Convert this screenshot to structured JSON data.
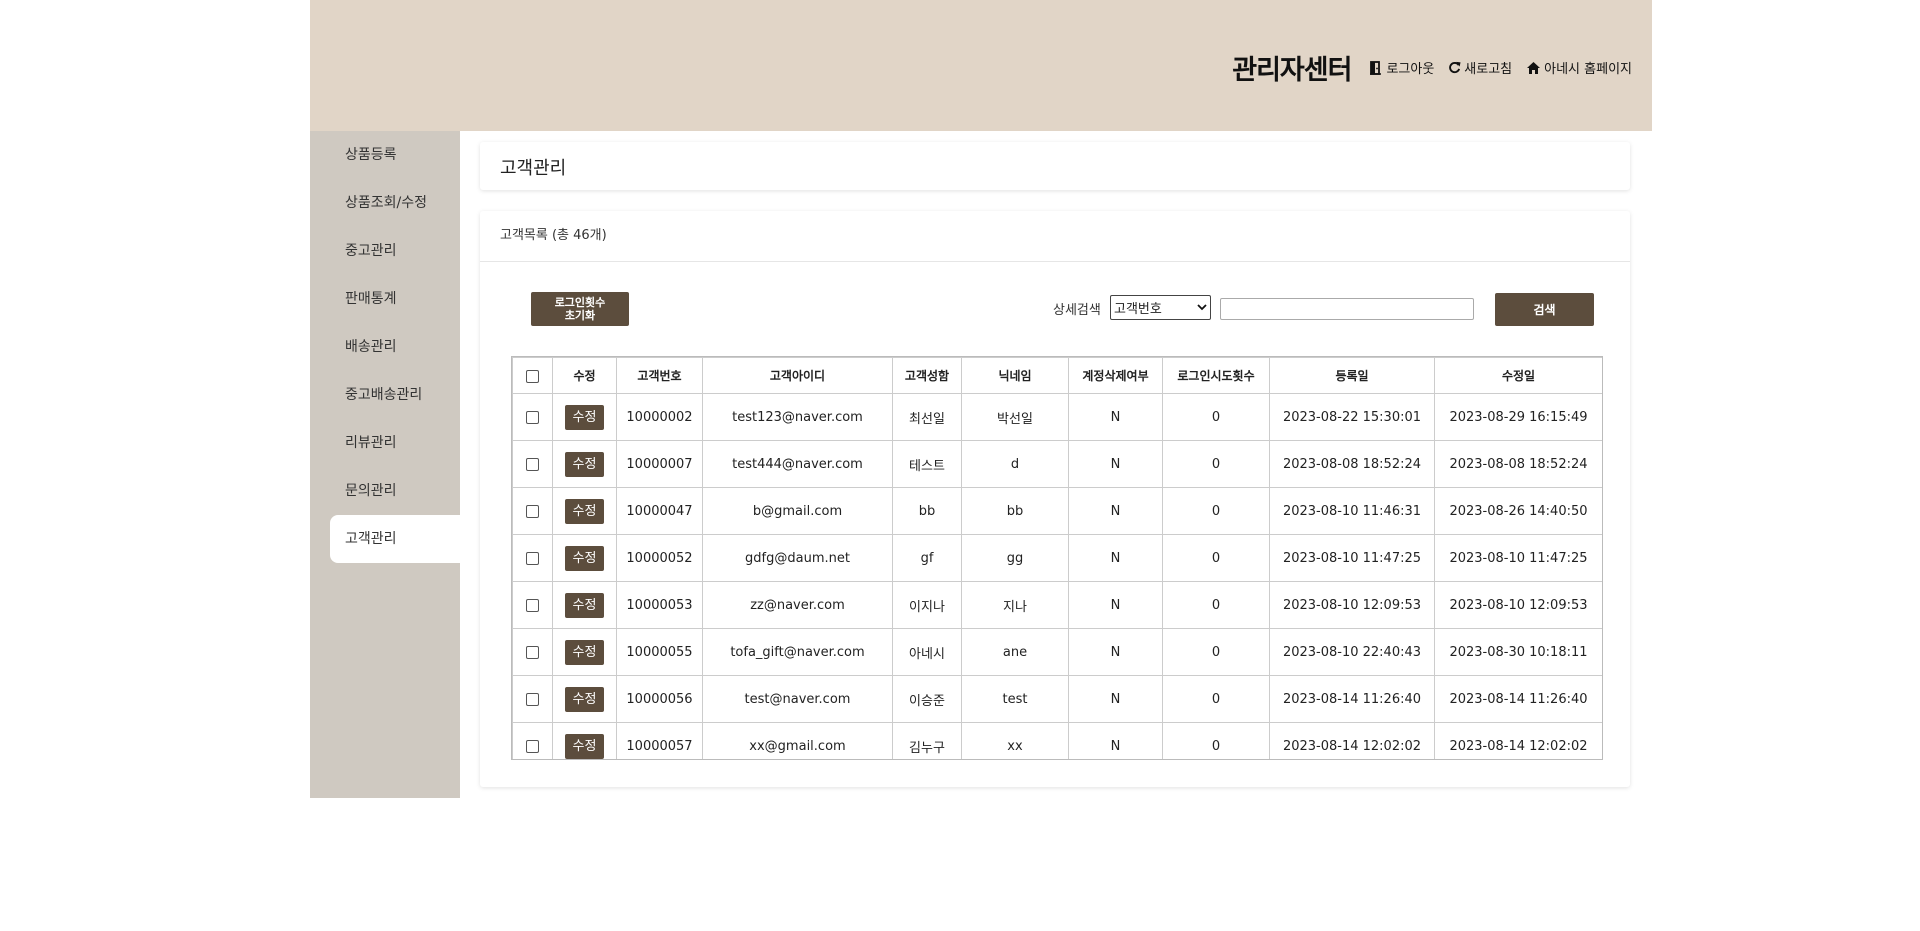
{
  "header": {
    "title": "관리자센터",
    "logout": "로그아웃",
    "refresh": "새로고침",
    "home": "아네시 홈페이지"
  },
  "sidebar": {
    "items": [
      {
        "label": "상품등록"
      },
      {
        "label": "상품조회/수정"
      },
      {
        "label": "중고관리"
      },
      {
        "label": "판매통계"
      },
      {
        "label": "배송관리"
      },
      {
        "label": "중고배송관리"
      },
      {
        "label": "리뷰관리"
      },
      {
        "label": "문의관리"
      },
      {
        "label": "고객관리",
        "active": true
      }
    ]
  },
  "page": {
    "title": "고객관리",
    "list_title": "고객목록 (총 46개)"
  },
  "toolbar": {
    "reset_label_1": "로그인횟수",
    "reset_label_2": "초기화",
    "search_label": "상세검색",
    "search_select_value": "고객번호",
    "search_input_value": "",
    "search_button": "검색"
  },
  "table": {
    "columns": [
      "수정",
      "고객번호",
      "고객아이디",
      "고객성함",
      "닉네임",
      "계정삭제여부",
      "로그인시도횟수",
      "등록일",
      "수정일"
    ],
    "edit_label": "수정",
    "rows": [
      {
        "id": "10000002",
        "email": "test123@naver.com",
        "name": "최선일",
        "nick": "박선일",
        "deleted": "N",
        "attempts": "0",
        "created": "2023-08-22 15:30:01",
        "updated": "2023-08-29 16:15:49"
      },
      {
        "id": "10000007",
        "email": "test444@naver.com",
        "name": "테스트",
        "nick": "d",
        "deleted": "N",
        "attempts": "0",
        "created": "2023-08-08 18:52:24",
        "updated": "2023-08-08 18:52:24"
      },
      {
        "id": "10000047",
        "email": "b@gmail.com",
        "name": "bb",
        "nick": "bb",
        "deleted": "N",
        "attempts": "0",
        "created": "2023-08-10 11:46:31",
        "updated": "2023-08-26 14:40:50"
      },
      {
        "id": "10000052",
        "email": "gdfg@daum.net",
        "name": "gf",
        "nick": "gg",
        "deleted": "N",
        "attempts": "0",
        "created": "2023-08-10 11:47:25",
        "updated": "2023-08-10 11:47:25"
      },
      {
        "id": "10000053",
        "email": "zz@naver.com",
        "name": "이지나",
        "nick": "지나",
        "deleted": "N",
        "attempts": "0",
        "created": "2023-08-10 12:09:53",
        "updated": "2023-08-10 12:09:53"
      },
      {
        "id": "10000055",
        "email": "tofa_gift@naver.com",
        "name": "아네시",
        "nick": "ane",
        "deleted": "N",
        "attempts": "0",
        "created": "2023-08-10 22:40:43",
        "updated": "2023-08-30 10:18:11"
      },
      {
        "id": "10000056",
        "email": "test@naver.com",
        "name": "이승준",
        "nick": "test",
        "deleted": "N",
        "attempts": "0",
        "created": "2023-08-14 11:26:40",
        "updated": "2023-08-14 11:26:40"
      },
      {
        "id": "10000057",
        "email": "xx@gmail.com",
        "name": "김누구",
        "nick": "xx",
        "deleted": "N",
        "attempts": "0",
        "created": "2023-08-14 12:02:02",
        "updated": "2023-08-14 12:02:02"
      }
    ]
  },
  "colors": {
    "header_bg": "#e1d5c7",
    "sidebar_bg": "#cfc9c1",
    "button_bg": "#5c4d3d"
  }
}
